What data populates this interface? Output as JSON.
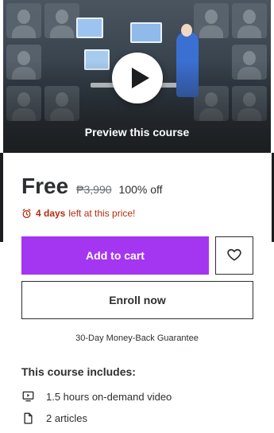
{
  "preview": {
    "label": "Preview this course",
    "icon": "play-icon"
  },
  "pricing": {
    "current": "Free",
    "original": "₱3,990",
    "discount": "100% off"
  },
  "deadline": {
    "icon": "alarm-clock-icon",
    "emphasis": "4 days",
    "rest": "left at this price!"
  },
  "actions": {
    "add_to_cart": "Add to cart",
    "wishlist_icon": "heart-icon",
    "enroll_now": "Enroll now"
  },
  "guarantee": "30-Day Money-Back Guarantee",
  "includes": {
    "title": "This course includes:",
    "items": [
      {
        "icon": "video-icon",
        "label": "1.5 hours on-demand video"
      },
      {
        "icon": "file-icon",
        "label": "2 articles"
      }
    ]
  },
  "colors": {
    "accent": "#a435f0",
    "deadline": "#b32d0f",
    "text": "#2d2f31"
  }
}
